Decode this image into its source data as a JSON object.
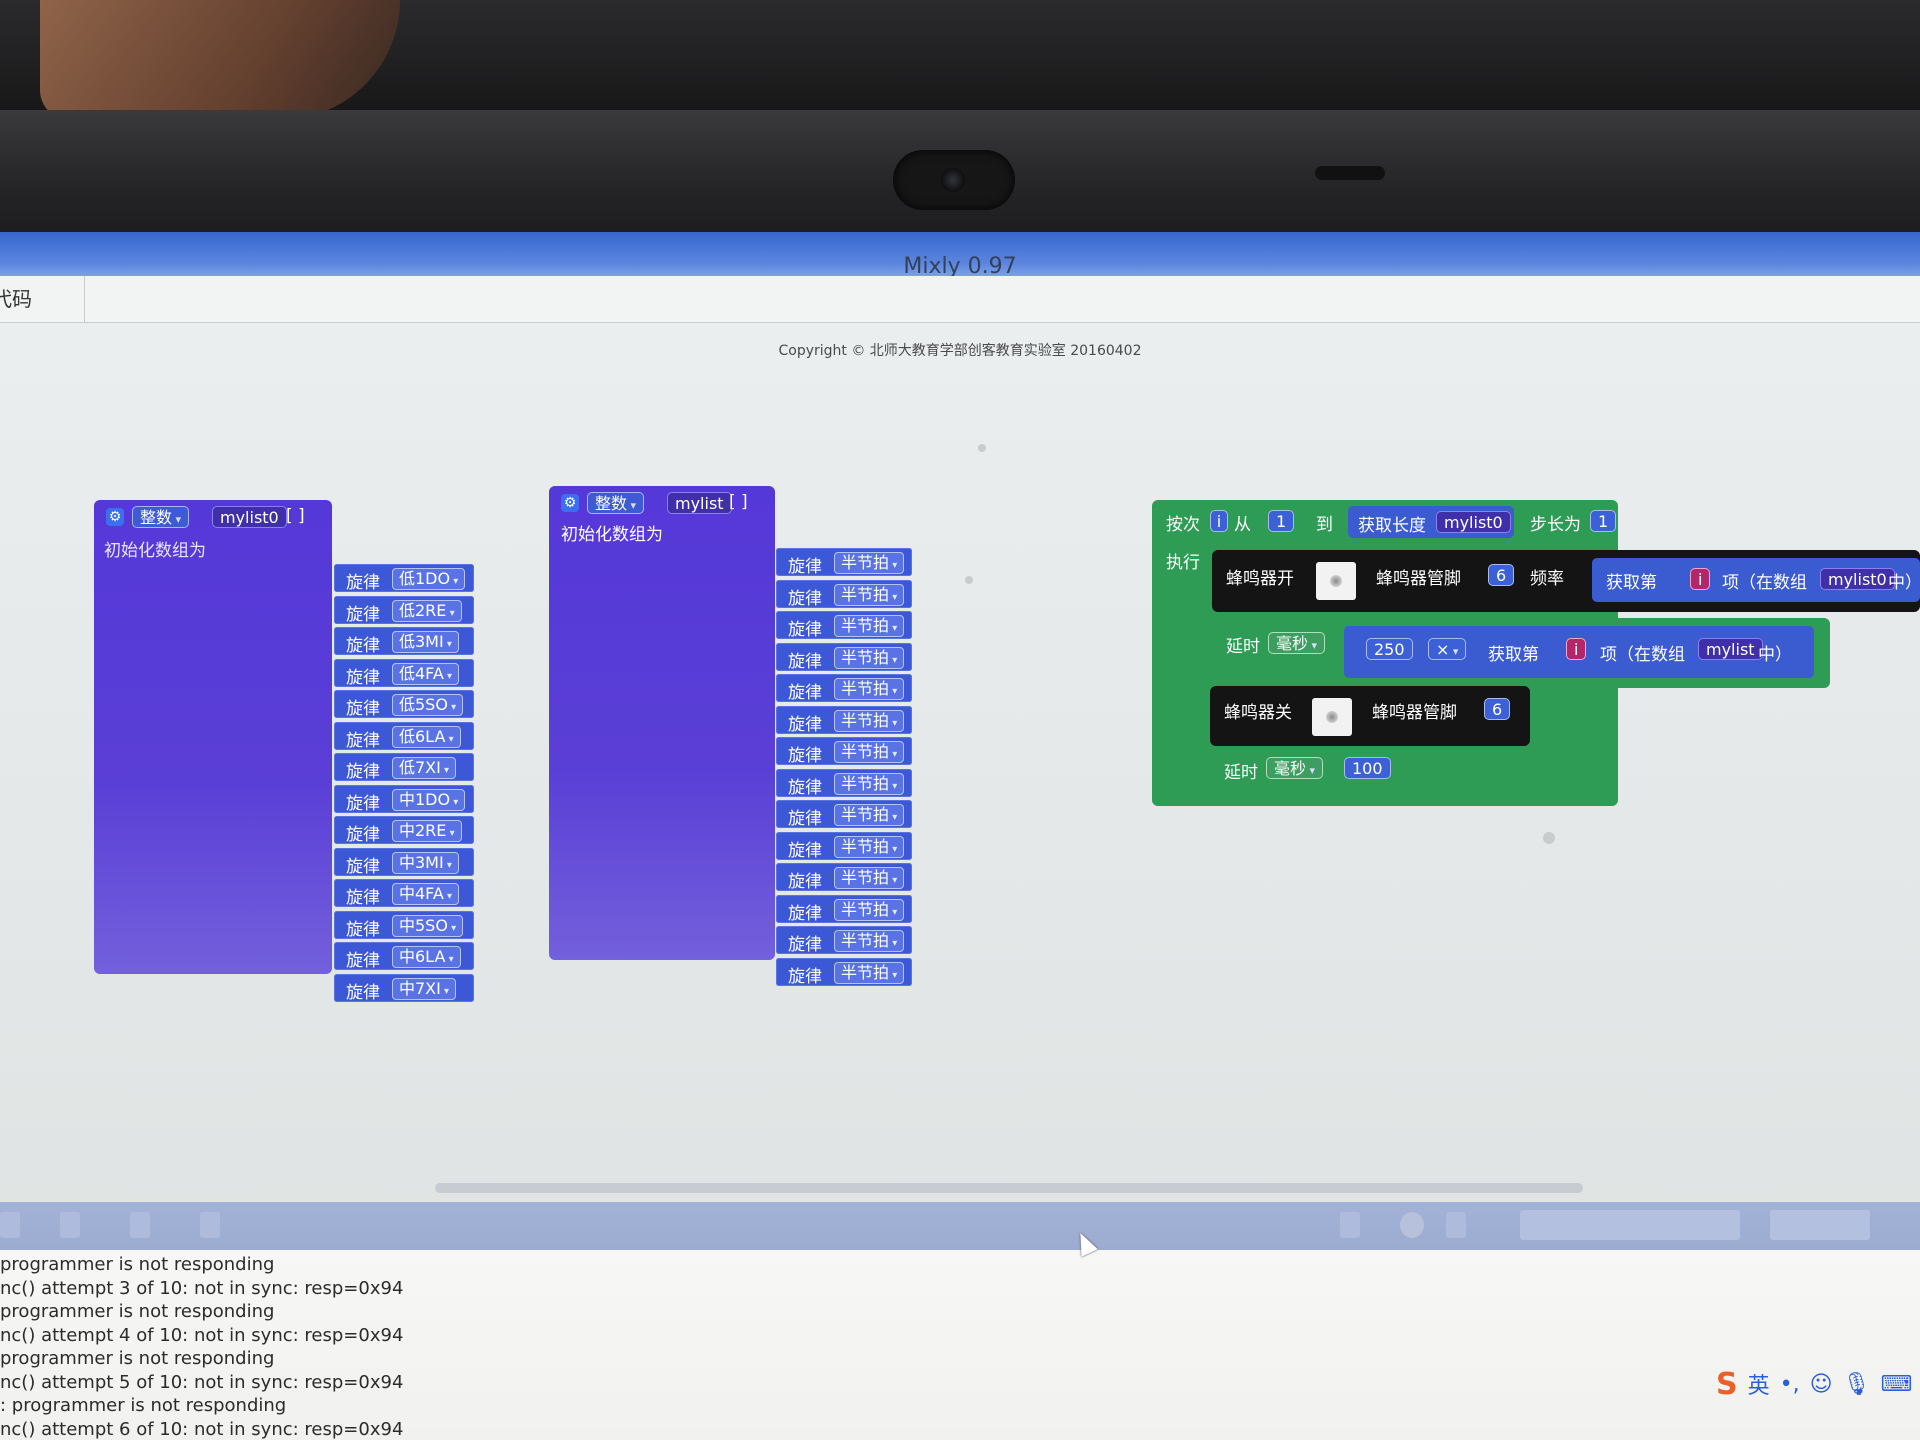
{
  "window": {
    "title": "Mixly 0.97",
    "copyright": "Copyright © 北师大教育学部创客教育实验室 20160402",
    "left_tab": "代码"
  },
  "block_array1": {
    "type_label": "整数",
    "name": "mylist0",
    "brackets": "[ ]",
    "init_label": "初始化数组为",
    "item_label": "旋律",
    "items": [
      "低1DO",
      "低2RE",
      "低3MI",
      "低4FA",
      "低5SO",
      "低6LA",
      "低7XI",
      "中1DO",
      "中2RE",
      "中3MI",
      "中4FA",
      "中5SO",
      "中6LA",
      "中7XI"
    ]
  },
  "block_array2": {
    "type_label": "整数",
    "name": "mylist",
    "brackets": "[ ]",
    "init_label": "初始化数组为",
    "item_label": "旋律",
    "items": [
      "半节拍",
      "半节拍",
      "半节拍",
      "半节拍",
      "半节拍",
      "半节拍",
      "半节拍",
      "半节拍",
      "半节拍",
      "半节拍",
      "半节拍",
      "半节拍",
      "半节拍",
      "半节拍"
    ]
  },
  "loop_block": {
    "for_label": "按次",
    "var": "i",
    "from_label": "从",
    "from_value": "1",
    "to_label": "到",
    "length_label": "获取长度",
    "length_array": "mylist0",
    "step_label": "步长为",
    "step_value": "1",
    "do_label": "执行",
    "buzzer_on": "蜂鸣器开",
    "pin_label": "蜂鸣器管脚",
    "pin_value": "6",
    "freq_label": "频率",
    "get_label": "获取第",
    "item_text": "项（在数组",
    "array1": "mylist0",
    "in_text": "中）",
    "delay_label": "延时",
    "ms_label": "毫秒",
    "delay1_value": "250",
    "multiply": "×",
    "array2": "mylist",
    "buzzer_off": "蜂鸣器关",
    "pin_value2": "6",
    "delay2_value": "100"
  },
  "console": {
    "lines": [
      "programmer is not responding",
      "nc() attempt 3 of 10: not in sync: resp=0x94",
      "programmer is not responding",
      "nc() attempt 4 of 10: not in sync: resp=0x94",
      "programmer is not responding",
      "nc() attempt 5 of 10: not in sync: resp=0x94",
      ": programmer is not responding",
      "nc() attempt 6 of 10: not in sync: resp=0x94"
    ]
  },
  "ime": {
    "logo": "S",
    "lang": "英",
    "punct": "•,",
    "emoji": "☺",
    "mic": "🎙",
    "keyboard": "⌨"
  },
  "colors": {
    "array_block": "#5a3fd6",
    "loop_block": "#2f9c55",
    "buzzer_block": "#141414",
    "titlebar": "#3766cf"
  }
}
